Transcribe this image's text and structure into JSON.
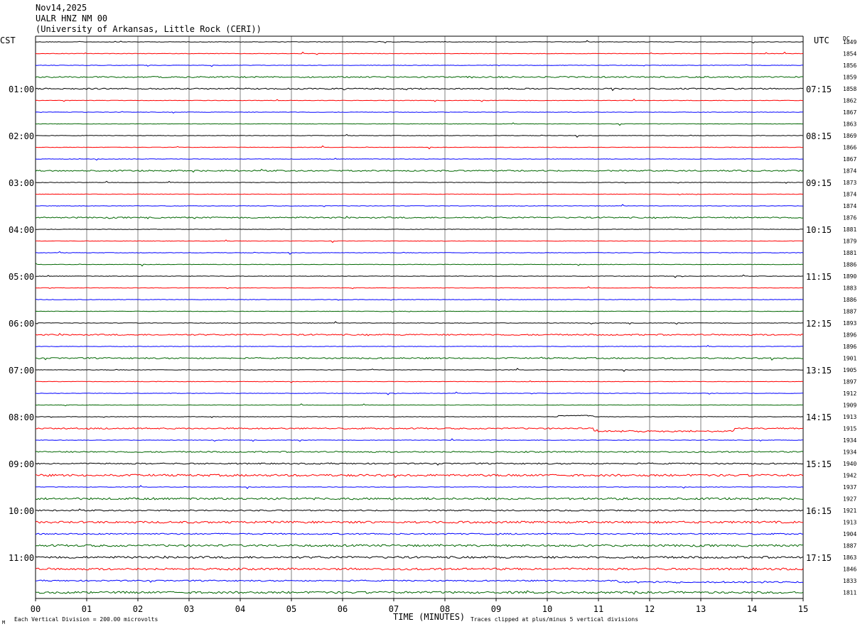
{
  "header": {
    "date": "Nov14,2025",
    "station": "UALR HNZ NM 00",
    "institution": "(University of Arkansas, Little Rock (CERI))"
  },
  "axes": {
    "left_zone": "CST",
    "right_zone": "UTC",
    "dc_header": "DC",
    "xlabel": "TIME (MINUTES)",
    "scale_note": "Each Vertical Division =  200.00 microvolts",
    "clip_note": "Traces clipped at plus/minus 5 vertical divisions",
    "corner_mark": "M"
  },
  "colors": {
    "trace_cycle": [
      "#000000",
      "#ff0000",
      "#0000ff",
      "#006600"
    ],
    "grid_line": "#808080",
    "frame": "#000000"
  },
  "chart_data": {
    "type": "line",
    "title": "",
    "x_ticks": [
      "00",
      "01",
      "02",
      "03",
      "04",
      "05",
      "06",
      "07",
      "08",
      "09",
      "10",
      "11",
      "12",
      "13",
      "14",
      "15"
    ],
    "xlim": [
      0,
      15
    ],
    "row_count": 48,
    "rows_per_hour": 4,
    "left_hour_labels": [
      "01:00",
      "02:00",
      "03:00",
      "04:00",
      "05:00",
      "06:00",
      "07:00",
      "08:00",
      "09:00",
      "10:00",
      "11:00"
    ],
    "right_hour_labels": [
      "07:15",
      "08:15",
      "09:15",
      "10:15",
      "11:15",
      "12:15",
      "13:15",
      "14:15",
      "15:15",
      "16:15",
      "17:15"
    ],
    "dc_values": [
      "1849",
      "1854",
      "1856",
      "1859",
      "1858",
      "1862",
      "1867",
      "1863",
      "1869",
      "1866",
      "1867",
      "1874",
      "1873",
      "1874",
      "1874",
      "1876",
      "1881",
      "1879",
      "1881",
      "1886",
      "1890",
      "1883",
      "1886",
      "1887",
      "1893",
      "1896",
      "1896",
      "1901",
      "1905",
      "1897",
      "1912",
      "1909",
      "1913",
      "1915",
      "1934",
      "1934",
      "1940",
      "1942",
      "1937",
      "1927",
      "1921",
      "1913",
      "1904",
      "1887",
      "1863",
      "1846",
      "1833",
      "1811"
    ],
    "noise_levels": [
      "quiet",
      "quiet",
      "quiet",
      "moderate",
      "moderate",
      "quiet",
      "quiet",
      "quiet",
      "quiet",
      "quiet",
      "quiet",
      "moderate",
      "quiet",
      "quiet",
      "quiet",
      "moderate",
      "quiet",
      "quiet",
      "quiet",
      "quiet",
      "quiet",
      "quiet",
      "quiet",
      "quiet",
      "quiet",
      "moderate",
      "quiet",
      "moderate",
      "quiet",
      "quiet",
      "quiet",
      "quiet",
      "quiet",
      "moderate",
      "quiet",
      "moderate",
      "moderate",
      "high",
      "quiet",
      "high",
      "moderate",
      "high",
      "moderate",
      "high",
      "high",
      "high",
      "moderate",
      "high"
    ],
    "notable_events": [
      {
        "row": 32,
        "from_min": 10.2,
        "to_min": 10.9,
        "amplitude_div": 0.3,
        "shape": "shift"
      },
      {
        "row": 33,
        "from_min": 10.9,
        "to_min": 13.65,
        "amplitude_div": -0.8,
        "shape": "step"
      },
      {
        "row": 46,
        "from_min": 11.3,
        "to_min": 15.0,
        "amplitude_div": -0.4,
        "shape": "step"
      }
    ]
  }
}
